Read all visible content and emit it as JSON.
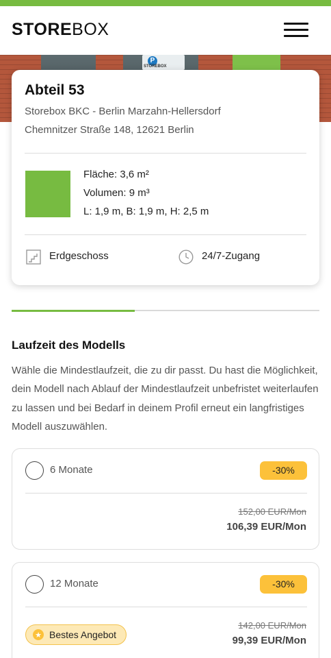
{
  "colors": {
    "brand_green": "#77bb41",
    "badge_yellow": "#fcc13a",
    "best_offer_bg": "#fde9b6",
    "best_offer_border": "#f3c24c"
  },
  "header": {
    "logo_bold": "STORE",
    "logo_light": "BOX",
    "menu_icon": "hamburger-menu-icon"
  },
  "hero": {
    "sign_letter": "P",
    "sign_text": "STOREBOX"
  },
  "unit": {
    "title": "Abteil 53",
    "location": "Storebox BKC - Berlin Marzahn-Hellersdorf",
    "address": "Chemnitzer Straße 148, 12621 Berlin",
    "area": "Fläche: 3,6 m²",
    "volume": "Volumen: 9 m³",
    "dimensions": "L: 1,9 m, B: 1,9 m, H: 2,5 m",
    "floor": "Erdgeschoss",
    "floor_icon": "stairs-icon",
    "access": "24/7-Zugang",
    "access_icon": "clock-icon"
  },
  "progress": {
    "step_fraction": 0.4
  },
  "term": {
    "title": "Laufzeit des Modells",
    "description": "Wähle die Mindestlaufzeit, die zu dir passt. Du hast die Möglichkeit, dein Modell nach Ablauf der Mindestlaufzeit unbefristet weiterlaufen zu lassen und bei Bedarf in deinem Profil erneut ein langfristiges Modell auszuwählen.",
    "options": [
      {
        "label": "6 Monate",
        "discount": "-30%",
        "old_price": "152,00 EUR/Mon",
        "new_price": "106,39 EUR/Mon",
        "selected": false
      },
      {
        "label": "12 Monate",
        "discount": "-30%",
        "old_price": "142,00 EUR/Mon",
        "new_price": "99,39 EUR/Mon",
        "best_offer": "Bestes Angebot",
        "best_offer_icon": "star-icon",
        "selected": false
      }
    ]
  }
}
